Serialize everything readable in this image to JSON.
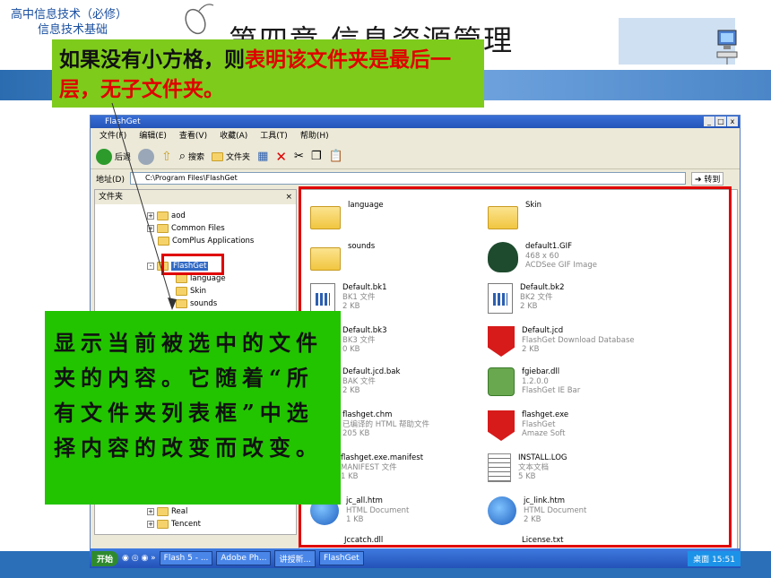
{
  "course": {
    "line1": "高中信息技术（必修）",
    "line2": "信息技术基础"
  },
  "chapter_title": "第四章   信息资源管理",
  "callout_top": {
    "black": "如果没有小方格，则",
    "red": "表明该文件夹是最后一层，无子文件夹。"
  },
  "callout_left": "显示当前被选中的文件夹的内容。它随着“所有文件夹列表框”中选择内容的改变而改变。",
  "window": {
    "title": "FlashGet",
    "menu": [
      "文件(F)",
      "编辑(E)",
      "查看(V)",
      "收藏(A)",
      "工具(T)",
      "帮助(H)"
    ],
    "toolbar": {
      "back": "后退",
      "search": "搜索",
      "folders": "文件夹"
    },
    "address_label": "地址(D)",
    "address_value": "C:\\Program Files\\FlashGet",
    "go_label": "转到",
    "folders_pane_title": "文件夹",
    "tree": [
      {
        "label": "aod",
        "pm": "+"
      },
      {
        "label": "Common Files",
        "pm": "+"
      },
      {
        "label": "ComPlus Applications",
        "pm": ""
      },
      {
        "label": "FlashGet",
        "pm": "-",
        "selected": true
      },
      {
        "label": "language",
        "pm": ""
      },
      {
        "label": "Skin",
        "pm": ""
      },
      {
        "label": "sounds",
        "pm": ""
      },
      {
        "label": "Real",
        "pm": "+"
      },
      {
        "label": "Tencent",
        "pm": "+"
      }
    ],
    "files": [
      {
        "name": "language",
        "type": "",
        "size": "",
        "icon": "folder-icon"
      },
      {
        "name": "Skin",
        "type": "",
        "size": "",
        "icon": "folder-icon"
      },
      {
        "name": "sounds",
        "type": "",
        "size": "",
        "icon": "folder-icon"
      },
      {
        "name": "default1.GIF",
        "type": "468 x 60",
        "size": "ACDSee GIF Image",
        "icon": "gif-icon"
      },
      {
        "name": "Default.bk1",
        "type": "BK1 文件",
        "size": "2 KB",
        "icon": "doc-icon"
      },
      {
        "name": "Default.bk2",
        "type": "BK2 文件",
        "size": "2 KB",
        "icon": "doc-icon"
      },
      {
        "name": "Default.bk3",
        "type": "BK3 文件",
        "size": "0 KB",
        "icon": "doc-icon"
      },
      {
        "name": "Default.jcd",
        "type": "FlashGet Download Database",
        "size": "2 KB",
        "icon": "flashget-icon"
      },
      {
        "name": "Default.jcd.bak",
        "type": "BAK 文件",
        "size": "2 KB",
        "icon": "doc-icon"
      },
      {
        "name": "fgiebar.dll",
        "type": "1.2.0.0",
        "size": "FlashGet IE Bar",
        "icon": "dll-icon"
      },
      {
        "name": "flashget.chm",
        "type": "已编译的 HTML 帮助文件",
        "size": "205 KB",
        "icon": "chm-icon"
      },
      {
        "name": "flashget.exe",
        "type": "FlashGet",
        "size": "Amaze Soft",
        "icon": "flashget-icon"
      },
      {
        "name": "flashget.exe.manifest",
        "type": "MANIFEST 文件",
        "size": "1 KB",
        "icon": "text-icon"
      },
      {
        "name": "INSTALL.LOG",
        "type": "文本文档",
        "size": "5 KB",
        "icon": "text-icon"
      },
      {
        "name": "jc_all.htm",
        "type": "HTML Document",
        "size": "1 KB",
        "icon": "ie-icon"
      },
      {
        "name": "jc_link.htm",
        "type": "HTML Document",
        "size": "2 KB",
        "icon": "ie-icon"
      },
      {
        "name": "Jccatch.dll",
        "type": "",
        "size": "",
        "icon": "dll-icon"
      },
      {
        "name": "License.txt",
        "type": "",
        "size": "",
        "icon": "text-icon"
      }
    ]
  },
  "taskbar": {
    "start": "开始",
    "tasks": [
      "Flash 5 - ...",
      "Adobe Ph...",
      "讲授新...",
      "FlashGet"
    ],
    "desktop": "桌面",
    "clock": "15:51"
  }
}
